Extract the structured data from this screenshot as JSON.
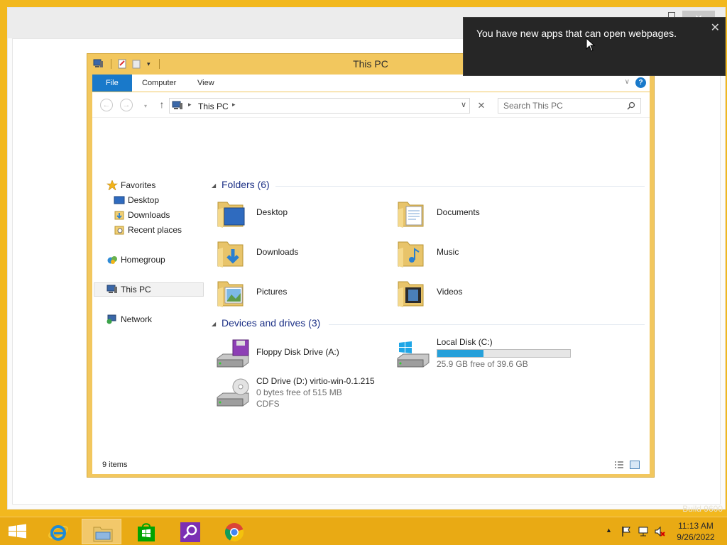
{
  "desktop": {
    "watermark": "Build 9600"
  },
  "explorer": {
    "title": "This PC",
    "ribbon_tabs": [
      "File",
      "Computer",
      "View"
    ],
    "address": {
      "crumb": "This PC"
    },
    "search": {
      "placeholder": "Search This PC"
    },
    "nav_pane": {
      "favorites": "Favorites",
      "desktop": "Desktop",
      "downloads": "Downloads",
      "recent_places": "Recent places",
      "homegroup": "Homegroup",
      "this_pc": "This PC",
      "network": "Network"
    },
    "folders_group": "Folders (6)",
    "folders": [
      {
        "name": "Desktop",
        "icon": "desktop-folder-icon"
      },
      {
        "name": "Documents",
        "icon": "documents-folder-icon"
      },
      {
        "name": "Downloads",
        "icon": "downloads-folder-icon"
      },
      {
        "name": "Music",
        "icon": "music-folder-icon"
      },
      {
        "name": "Pictures",
        "icon": "pictures-folder-icon"
      },
      {
        "name": "Videos",
        "icon": "videos-folder-icon"
      }
    ],
    "drives_group": "Devices and drives (3)",
    "drives": [
      {
        "name": "Floppy Disk Drive (A:)",
        "icon": "floppy-drive-icon"
      },
      {
        "name": "Local Disk (C:)",
        "free": "25.9 GB free of 39.6 GB",
        "used_fraction": 0.346,
        "icon": "local-disk-icon"
      },
      {
        "name": "CD Drive (D:) virtio-win-0.1.215",
        "free": "0 bytes free of 515 MB",
        "fs": "CDFS",
        "icon": "cd-drive-icon"
      }
    ],
    "status": {
      "items": "9 items"
    }
  },
  "toast": {
    "message": "You have new apps that can open webpages.",
    "close": "✕"
  },
  "taskbar": {
    "apps": [
      "internet-explorer-icon",
      "file-explorer-icon",
      "store-icon",
      "search-icon",
      "chrome-icon"
    ],
    "time": "11:13 AM",
    "date": "9/26/2022"
  },
  "colors": {
    "accent": "#1979ca",
    "desktop": "#f2b81e",
    "window_frame": "#f2c75e",
    "drive_bar": "#26a0da"
  }
}
